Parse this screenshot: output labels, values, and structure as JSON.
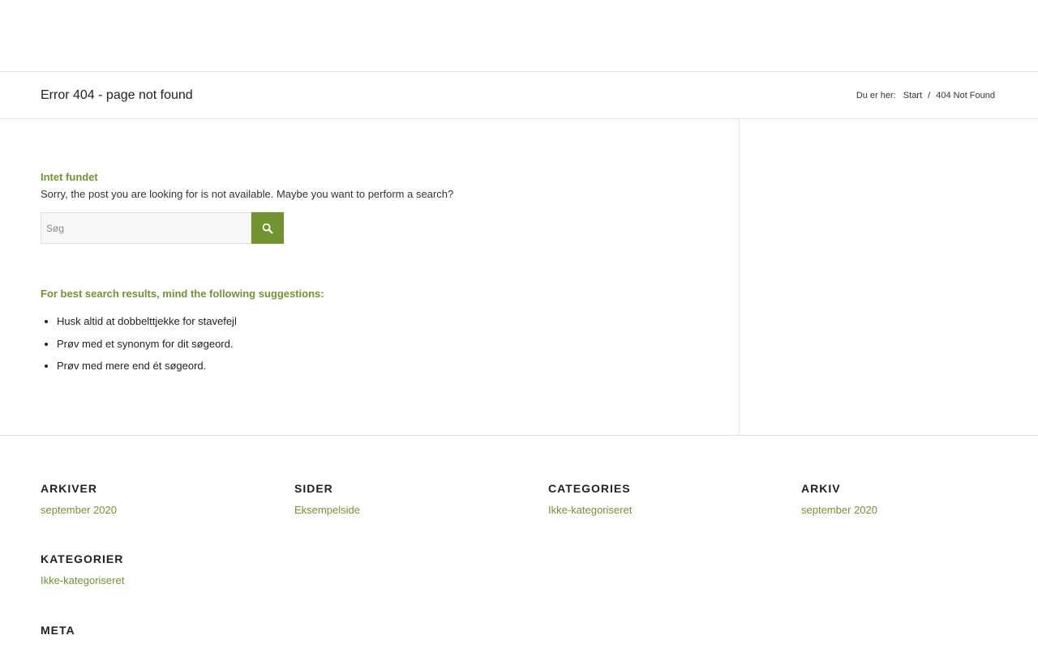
{
  "page": {
    "title": "Error 404 - page not found"
  },
  "breadcrumb": {
    "prefix": "Du er her:",
    "home": "Start",
    "separator": "/",
    "current": "404 Not Found"
  },
  "not_found": {
    "heading": "Intet fundet",
    "text": "Sorry, the post you are looking for is not available. Maybe you want to perform a search?"
  },
  "search": {
    "placeholder": "Søg",
    "value": "",
    "button_icon": "search-icon"
  },
  "suggestions": {
    "heading": "For best search results, mind the following suggestions:",
    "items": [
      "Husk altid at dobbelttjekke for stavefejl",
      "Prøv med et synonym for dit søgeord.",
      "Prøv med mere end ét søgeord."
    ]
  },
  "footer": {
    "arkiver": {
      "title": "ARKIVER",
      "link": "september 2020"
    },
    "sider": {
      "title": "SIDER",
      "link": "Eksempelside"
    },
    "categories": {
      "title": "CATEGORIES",
      "link": "Ikke-kategoriseret"
    },
    "arkiv": {
      "title": "ARKIV",
      "link": "september 2020"
    },
    "kategorier": {
      "title": "KATEGORIER",
      "link": "Ikke-kategoriseret"
    },
    "meta": {
      "title": "META"
    }
  },
  "colors": {
    "accent": "#719430",
    "border": "#e1e1e1",
    "text": "#333333"
  }
}
